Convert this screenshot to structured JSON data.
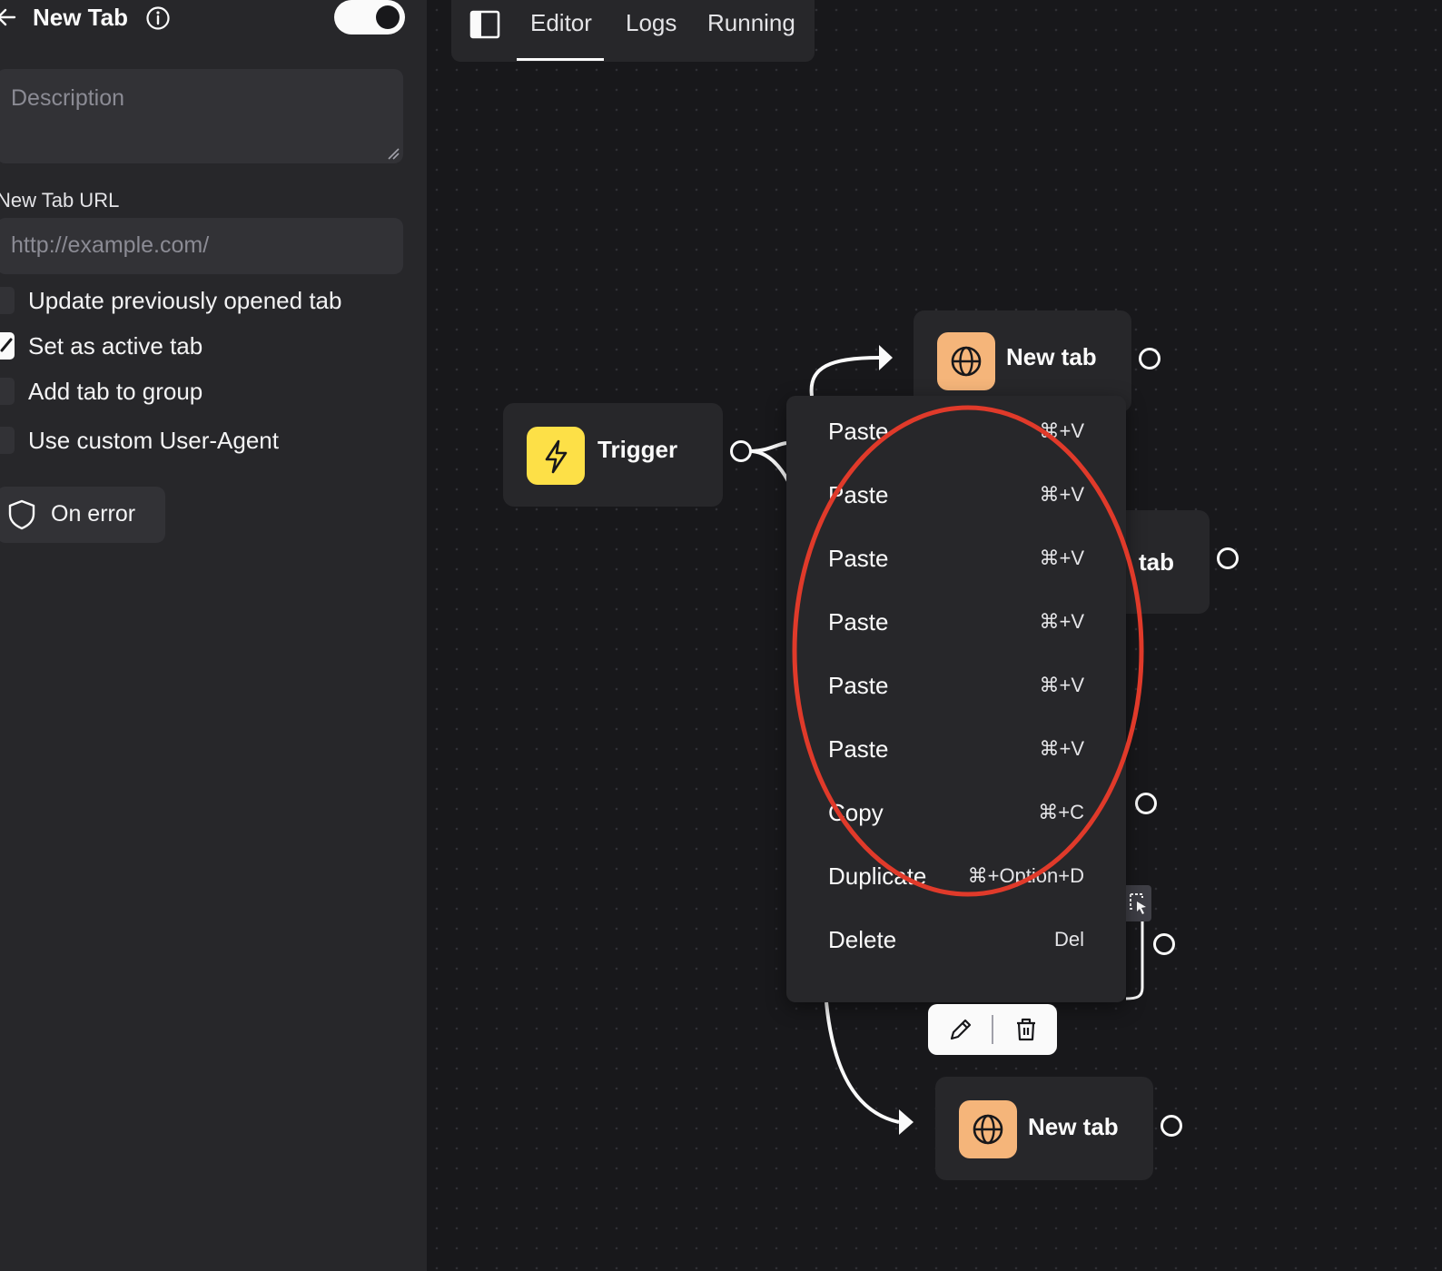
{
  "sidebar": {
    "title": "New Tab",
    "description_placeholder": "Description",
    "url_label": "New Tab URL",
    "url_placeholder": "http://example.com/",
    "options": [
      {
        "label": "Update previously opened tab",
        "checked": false
      },
      {
        "label": "Set as active tab",
        "checked": true
      },
      {
        "label": "Add tab to group",
        "checked": false
      },
      {
        "label": "Use custom User-Agent",
        "checked": false
      }
    ],
    "on_error_label": "On error",
    "toggle_on": true
  },
  "tabs": [
    {
      "label": "Editor",
      "active": true
    },
    {
      "label": "Logs",
      "active": false
    },
    {
      "label": "Running",
      "active": false
    }
  ],
  "nodes": {
    "trigger": {
      "label": "Trigger",
      "icon": "bolt-icon",
      "color": "#fde047"
    },
    "new_tab_top": {
      "label": "New tab",
      "icon": "globe-icon",
      "color": "#f5b57a"
    },
    "new_tab_mid": {
      "label": "tab"
    },
    "new_tab_bottom": {
      "label": "New tab",
      "icon": "globe-icon",
      "color": "#f5b57a"
    }
  },
  "context_menu": [
    {
      "label": "Paste",
      "shortcut": "⌘+V"
    },
    {
      "label": "Paste",
      "shortcut": "⌘+V"
    },
    {
      "label": "Paste",
      "shortcut": "⌘+V"
    },
    {
      "label": "Paste",
      "shortcut": "⌘+V"
    },
    {
      "label": "Paste",
      "shortcut": "⌘+V"
    },
    {
      "label": "Paste",
      "shortcut": "⌘+V"
    },
    {
      "label": "Copy",
      "shortcut": "⌘+C"
    },
    {
      "label": "Duplicate",
      "shortcut": "⌘+Option+D"
    },
    {
      "label": "Delete",
      "shortcut": "Del"
    }
  ],
  "annotation": {
    "color": "#e03a2a"
  }
}
